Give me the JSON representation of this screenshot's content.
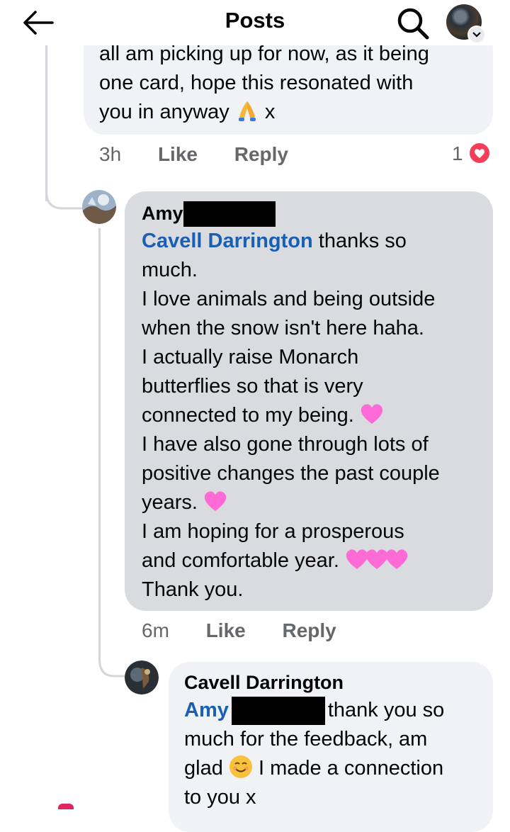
{
  "header": {
    "title": "Posts",
    "back_icon": "arrow-left-icon",
    "search_icon": "search-icon"
  },
  "comment1": {
    "lines": [
      "all am picking up for now, as it being",
      "one card, hope this resonated with",
      "you in anyway"
    ],
    "suffix": "x",
    "time": "3h",
    "like": "Like",
    "reply": "Reply",
    "reaction_count": "1"
  },
  "comment2": {
    "author": "Amy",
    "mention": "Cavell Darrington",
    "lines": [
      "thanks so",
      "much.",
      "I love animals and being outside",
      "when the snow isn't here haha.",
      "I actually raise Monarch",
      "butterflies so that is very",
      "connected to my being.",
      "I have also gone through lots of",
      "positive changes the past couple",
      "years.",
      "I am hoping for a prosperous",
      "and comfortable year.",
      "Thank you."
    ],
    "time": "6m",
    "like": "Like",
    "reply": "Reply"
  },
  "comment3": {
    "author": "Cavell Darrington",
    "mention": "Amy",
    "lines": [
      "thank you so",
      "much for the feedback, am",
      "glad",
      "I made a connection",
      "to you x"
    ]
  },
  "colors": {
    "mention": "#1a5fb4",
    "heart_pink": "#ff6bd6",
    "love_reaction": "#f33e58"
  }
}
